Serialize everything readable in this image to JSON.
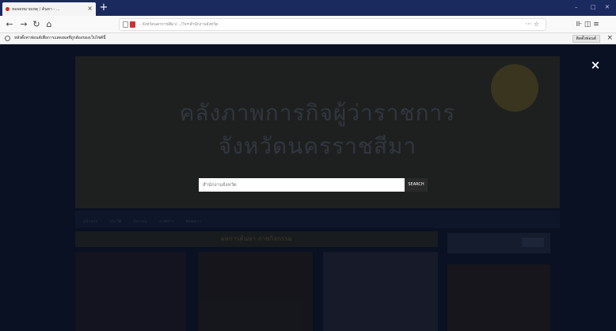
{
  "browser": {
    "tab_title": "หอจดหมายเหตุ / ค้นหา - ... ",
    "new_tab": "+",
    "url": "...จังหวัดนครราชสีมา/.../?s=สำนักงานจังหวัด",
    "url_actions": "··· ☆",
    "right_icons": "⊪ ◫ ≡",
    "window_controls": [
      "–",
      "□",
      "✕"
    ]
  },
  "notification": {
    "text": "หลังตั้งค่าฟอนต์เพื่อการแสดงผลที่ถูกต้องของเว็บไซต์นี้",
    "button": "ติดตั้งฟอนต์",
    "close": "×"
  },
  "page": {
    "hero_line1": "คลังภาพการกิจผู้ว่าราชการ",
    "hero_line2": "จังหวัดนครราชสีมา",
    "section_title": "ผลการค้นหา ภาพกิจกรรม",
    "nav_items": [
      "หน้าแรก",
      "ประวัติ",
      "กิจกรรม",
      "ภาพข่าว",
      "ติดต่อเรา"
    ]
  },
  "search": {
    "value": "สำนักงานจังหวัด",
    "button": "SEARCH"
  },
  "overlay": {
    "close": "×"
  },
  "colors": {
    "overlay": "#060c1c",
    "search_button": "#2a2a2a",
    "tab_strip": "#1b2a5e"
  }
}
